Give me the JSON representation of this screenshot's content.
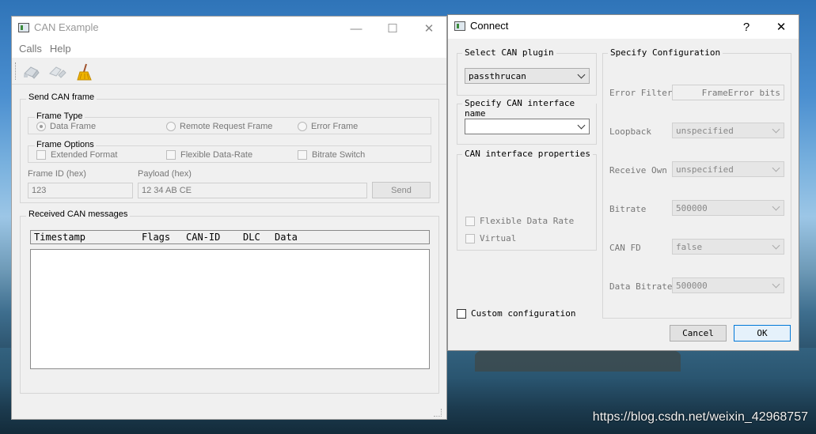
{
  "main_window": {
    "title": "CAN Example",
    "menu": [
      "Calls",
      "Help"
    ],
    "controls": {
      "minimize": "—",
      "maximize": "☐",
      "close": "✕"
    },
    "toolbar": [
      "connect-icon",
      "disconnect-icon",
      "clear-icon"
    ],
    "send_group": {
      "title": "Send CAN frame",
      "frame_type_legend": "Frame Type",
      "frame_types": [
        "Data Frame",
        "Remote Request Frame",
        "Error Frame"
      ],
      "frame_options_legend": "Frame Options",
      "frame_options": [
        "Extended Format",
        "Flexible Data-Rate",
        "Bitrate Switch"
      ],
      "frame_id_label": "Frame ID (hex)",
      "frame_id_value": "123",
      "payload_label": "Payload (hex)",
      "payload_value": "12 34 AB CE",
      "send_label": "Send"
    },
    "received_group": {
      "title": "Received CAN messages",
      "columns": [
        "Timestamp",
        "Flags",
        "CAN-ID",
        "DLC",
        "Data"
      ]
    }
  },
  "connect_dialog": {
    "title": "Connect",
    "help": "?",
    "close": "✕",
    "plugin_group": {
      "title": "Select CAN plugin",
      "value": "passthrucan"
    },
    "interface_group": {
      "title": "Specify CAN interface name",
      "value": ""
    },
    "props_group": {
      "title": "CAN interface properties",
      "options": [
        "Flexible Data Rate",
        "Virtual"
      ]
    },
    "custom_config_label": "Custom configuration",
    "config_group": {
      "title": "Specify Configuration",
      "error_filter_label": "Error Filter",
      "error_filter_value": "FrameError bits",
      "loopback_label": "Loopback",
      "loopback_value": "unspecified",
      "receive_own_label": "Receive Own",
      "receive_own_value": "unspecified",
      "bitrate_label": "Bitrate",
      "bitrate_value": "500000",
      "canfd_label": "CAN FD",
      "canfd_value": "false",
      "data_bitrate_label": "Data Bitrate",
      "data_bitrate_value": "500000"
    },
    "cancel_label": "Cancel",
    "ok_label": "OK"
  },
  "watermark": "https://blog.csdn.net/weixin_42968757"
}
